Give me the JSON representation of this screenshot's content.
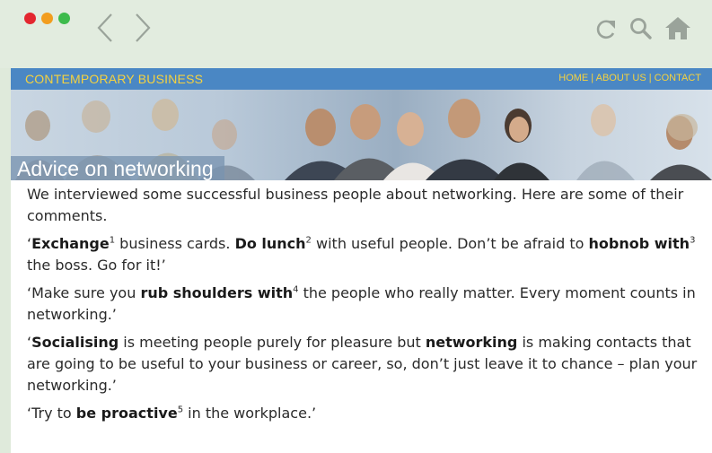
{
  "browser": {
    "buttons": {
      "back": "back-icon",
      "forward": "forward-icon",
      "reload": "reload-icon",
      "search": "search-icon",
      "home": "home-icon"
    },
    "colors": {
      "close": "#e3262f",
      "minimize": "#f29d1e",
      "maximize": "#3dbb4c",
      "icon": "#9aa39a"
    }
  },
  "site": {
    "title": "CONTEMPORARY BUSINESS",
    "nav": {
      "home": "HOME",
      "sep1": " | ",
      "about": "ABOUT US",
      "sep2": " | ",
      "contact": "CONTACT"
    },
    "colors": {
      "bar": "#4a87c4",
      "text": "#f5d23f"
    }
  },
  "hero": {
    "caption": "Advice on networking"
  },
  "article": {
    "intro": "We interviewed some successful business people about networking. Here are some of their comments.",
    "q1": {
      "open": "‘",
      "t1": "Exchange",
      "n1": "1",
      "s1": " business cards. ",
      "t2": "Do lunch",
      "n2": "2",
      "s2": " with useful people. Don’t be afraid to ",
      "t3": "hobnob with",
      "n3": "3",
      "s3": " the boss. Go for it!’"
    },
    "q2": {
      "s1": "‘Make sure you ",
      "t1": "rub shoulders with",
      "n1": "4",
      "s2": " the people who really matter. Every moment counts in networking.’"
    },
    "q3": {
      "open": "‘",
      "t1": "Socialising",
      "s1": " is meeting people purely for pleasure but ",
      "t2": "networking",
      "s2": " is making contacts that are going to be useful to your business or career, so, don’t just leave it to chance – plan your networking.’"
    },
    "q4": {
      "s1": "‘Try to ",
      "t1": "be proactive",
      "n1": "5",
      "s2": " in the workplace.’"
    }
  }
}
